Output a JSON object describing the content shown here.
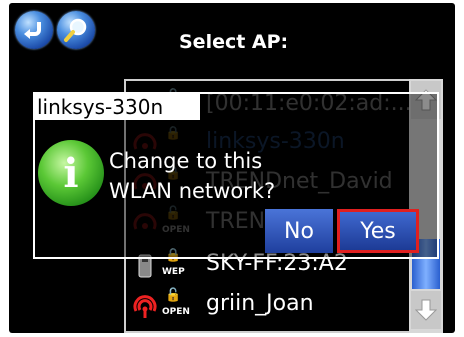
{
  "header": {
    "title": "Select AP:",
    "back_icon": "back-arrow-icon",
    "search_icon": "magnifier-icon"
  },
  "ap_list": {
    "items": [
      {
        "name": "[00:11:e0:02:ad:...",
        "security": "",
        "selected": false
      },
      {
        "name": "linksys-330n",
        "security": "",
        "selected": true
      },
      {
        "name": "TRENDnet_David",
        "security": "",
        "selected": false
      },
      {
        "name": "TREN",
        "security": "OPEN",
        "selected": false
      },
      {
        "name": "SKY-FF:23:A2",
        "security": "WEP",
        "selected": false
      },
      {
        "name": "griin_Joan",
        "security": "OPEN",
        "selected": false
      }
    ]
  },
  "dialog": {
    "title": "linksys-330n",
    "message_line1": "Change to this",
    "message_line2": "WLAN network?",
    "no_label": "No",
    "yes_label": "Yes",
    "icon": "info-icon"
  },
  "colors": {
    "accent_blue": "#2a5fcf",
    "highlight_red": "#e02020",
    "info_green": "#3cae2a"
  }
}
